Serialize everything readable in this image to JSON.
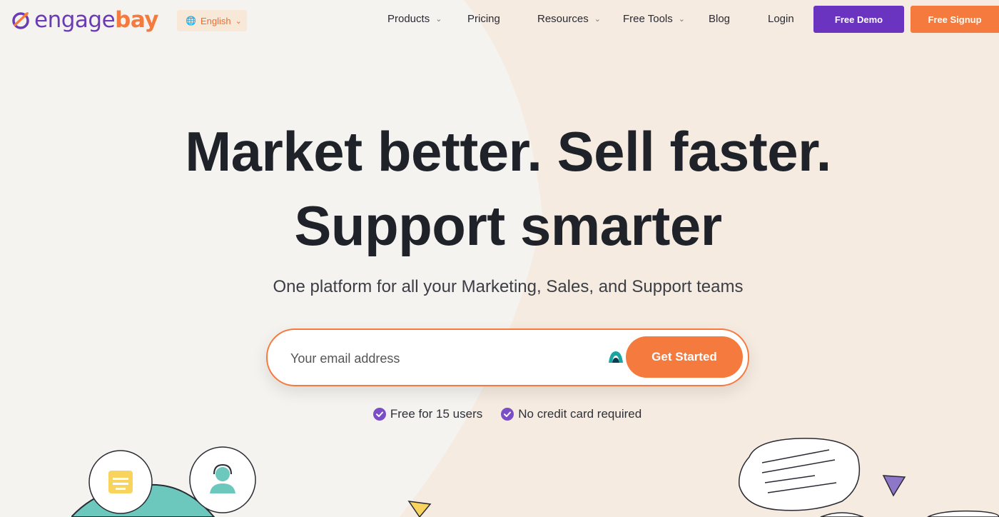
{
  "brand": {
    "name_part1": "engage",
    "name_part2": "bay",
    "purple": "#6a33c0",
    "orange": "#f47a3e"
  },
  "language": {
    "icon": "globe-icon",
    "selected": "English"
  },
  "nav": {
    "items": [
      {
        "label": "Products",
        "has_dropdown": true
      },
      {
        "label": "Pricing",
        "has_dropdown": false
      },
      {
        "label": "Resources",
        "has_dropdown": true
      },
      {
        "label": "Free Tools",
        "has_dropdown": true
      },
      {
        "label": "Blog",
        "has_dropdown": false
      },
      {
        "label": "Login",
        "has_dropdown": false
      }
    ],
    "demo_label": "Free Demo",
    "signup_label": "Free Signup"
  },
  "hero": {
    "title_line1": "Market better. Sell faster.",
    "title_line2": "Support smarter",
    "subtitle": "One platform for all your Marketing, Sales, and Support teams",
    "email_placeholder": "Your email address",
    "email_value": "",
    "cta_label": "Get Started",
    "perks": [
      {
        "icon": "check-circle-icon",
        "label": "Free for 15 users"
      },
      {
        "icon": "check-circle-icon",
        "label": "No credit card required"
      }
    ]
  }
}
